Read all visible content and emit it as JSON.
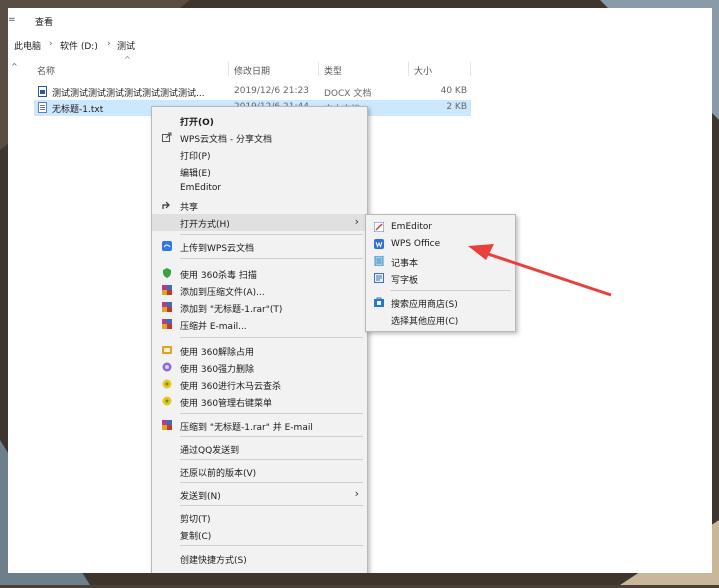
{
  "menubar": {
    "view_tab": "查看",
    "edge_mark": "="
  },
  "breadcrumb": [
    "此电脑",
    "软件 (D:)",
    "测试"
  ],
  "columns": {
    "name": "名称",
    "date": "修改日期",
    "type": "类型",
    "size": "大小"
  },
  "files": [
    {
      "name": "测试测试测试测试测试测试测试测试...",
      "date": "2019/12/6 21:23",
      "type": "DOCX 文档",
      "size": "40 KB",
      "selected": false
    },
    {
      "name": "无标题-1.txt",
      "date": "2019/12/6 21:44",
      "type": "文本文档",
      "size": "2 KB",
      "selected": true
    }
  ],
  "context_menu": {
    "items": [
      {
        "label": "打开(O)",
        "icon": "none",
        "bold": true
      },
      {
        "label": "WPS云文档 - 分享文档",
        "icon": "share-out-icon"
      },
      {
        "label": "打印(P)",
        "icon": "none"
      },
      {
        "label": "编辑(E)",
        "icon": "none"
      },
      {
        "label": "EmEditor",
        "icon": "none"
      },
      {
        "label": "共享",
        "icon": "share-icon"
      },
      {
        "label": "打开方式(H)",
        "icon": "none",
        "submenu": true
      },
      {
        "label": "上传到WPS云文档",
        "icon": "wps-cloud-icon"
      },
      {
        "label": "使用 360杀毒 扫描",
        "icon": "360-antivirus-icon"
      },
      {
        "label": "添加到压缩文件(A)...",
        "icon": "winrar-icon"
      },
      {
        "label": "添加到 \"无标题-1.rar\"(T)",
        "icon": "winrar-icon"
      },
      {
        "label": "压缩并 E-mail...",
        "icon": "winrar-icon"
      },
      {
        "label": "使用 360解除占用",
        "icon": "360-unlock-icon"
      },
      {
        "label": "使用 360强力删除",
        "icon": "360-delete-icon"
      },
      {
        "label": "使用 360进行木马云查杀",
        "icon": "360-guard-icon"
      },
      {
        "label": "使用 360管理右键菜单",
        "icon": "360-guard-icon"
      },
      {
        "label": "压缩到 \"无标题-1.rar\" 并 E-mail",
        "icon": "winrar-icon"
      },
      {
        "label": "通过QQ发送到",
        "icon": "none"
      },
      {
        "label": "还原以前的版本(V)",
        "icon": "none"
      },
      {
        "label": "发送到(N)",
        "icon": "none",
        "submenu": true
      },
      {
        "label": "剪切(T)",
        "icon": "none"
      },
      {
        "label": "复制(C)",
        "icon": "none"
      },
      {
        "label": "创建快捷方式(S)",
        "icon": "none"
      }
    ]
  },
  "open_with_submenu": {
    "items": [
      {
        "label": "EmEditor",
        "icon": "emeditor-icon"
      },
      {
        "label": "WPS Office",
        "icon": "wps-office-icon"
      },
      {
        "label": "记事本",
        "icon": "notepad-icon"
      },
      {
        "label": "写字板",
        "icon": "wordpad-icon"
      },
      {
        "label": "搜索应用商店(S)",
        "icon": "store-icon"
      },
      {
        "label": "选择其他应用(C)",
        "icon": "none"
      }
    ]
  },
  "colors": {
    "selection": "#cce8ff",
    "annotation_arrow": "#e8403a",
    "menu_bg": "#f2f2f2"
  }
}
